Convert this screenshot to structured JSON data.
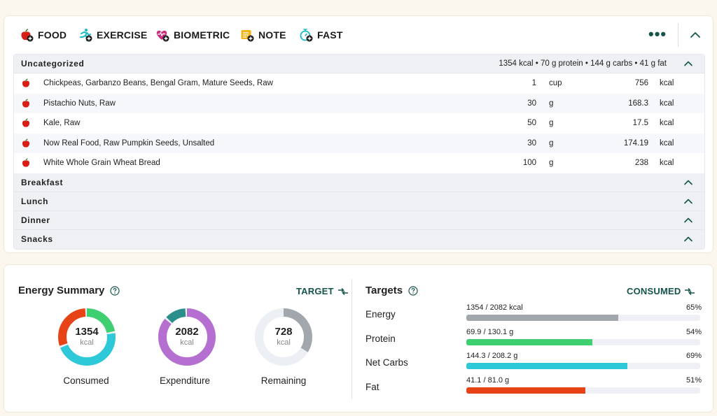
{
  "toolbar": {
    "items": [
      {
        "label": "FOOD",
        "icon": "apple-add-icon"
      },
      {
        "label": "EXERCISE",
        "icon": "runner-add-icon"
      },
      {
        "label": "BIOMETRIC",
        "icon": "heart-add-icon"
      },
      {
        "label": "NOTE",
        "icon": "note-add-icon"
      },
      {
        "label": "FAST",
        "icon": "stopwatch-add-icon"
      }
    ],
    "more_label": "•••"
  },
  "diary": {
    "uncategorized": {
      "title": "Uncategorized",
      "summary": "1354 kcal • 70 g protein • 144 g carbs • 41 g fat",
      "items": [
        {
          "name": "Chickpeas, Garbanzo Beans, Bengal Gram, Mature Seeds, Raw",
          "amount": "1",
          "unit": "cup",
          "calories": "756",
          "cal_unit": "kcal"
        },
        {
          "name": "Pistachio Nuts, Raw",
          "amount": "30",
          "unit": "g",
          "calories": "168.3",
          "cal_unit": "kcal"
        },
        {
          "name": "Kale, Raw",
          "amount": "50",
          "unit": "g",
          "calories": "17.5",
          "cal_unit": "kcal"
        },
        {
          "name": "Now Real Food, Raw Pumpkin Seeds, Unsalted",
          "amount": "30",
          "unit": "g",
          "calories": "174.19",
          "cal_unit": "kcal"
        },
        {
          "name": "White Whole Grain Wheat Bread",
          "amount": "100",
          "unit": "g",
          "calories": "238",
          "cal_unit": "kcal"
        }
      ]
    },
    "groups": [
      "Breakfast",
      "Lunch",
      "Dinner",
      "Snacks"
    ]
  },
  "energy_summary": {
    "title": "Energy Summary",
    "toggle_label": "TARGET",
    "consumed": {
      "value": "1354",
      "unit": "kcal",
      "label": "Consumed"
    },
    "expenditure": {
      "value": "2082",
      "unit": "kcal",
      "label": "Expenditure"
    },
    "remaining": {
      "value": "728",
      "unit": "kcal",
      "label": "Remaining"
    },
    "colors": {
      "green": "#3ecf71",
      "cyan": "#2ec9d8",
      "red": "#e84316",
      "purple": "#b46fd1",
      "teal": "#2a8f8a",
      "gray": "#a2a6ad",
      "track": "#eceff3"
    }
  },
  "targets": {
    "title": "Targets",
    "toggle_label": "CONSUMED",
    "rows": [
      {
        "name": "Energy",
        "value": "1354 / 2082 kcal",
        "percent": "65%",
        "fraction": 0.65,
        "color": "#a2a6ad"
      },
      {
        "name": "Protein",
        "value": "69.9 / 130.1 g",
        "percent": "54%",
        "fraction": 0.54,
        "color": "#3ecf71"
      },
      {
        "name": "Net Carbs",
        "value": "144.3 / 208.2 g",
        "percent": "69%",
        "fraction": 0.69,
        "color": "#2ec9d8"
      },
      {
        "name": "Fat",
        "value": "41.1 / 81.0 g",
        "percent": "51%",
        "fraction": 0.51,
        "color": "#e84316"
      }
    ]
  }
}
